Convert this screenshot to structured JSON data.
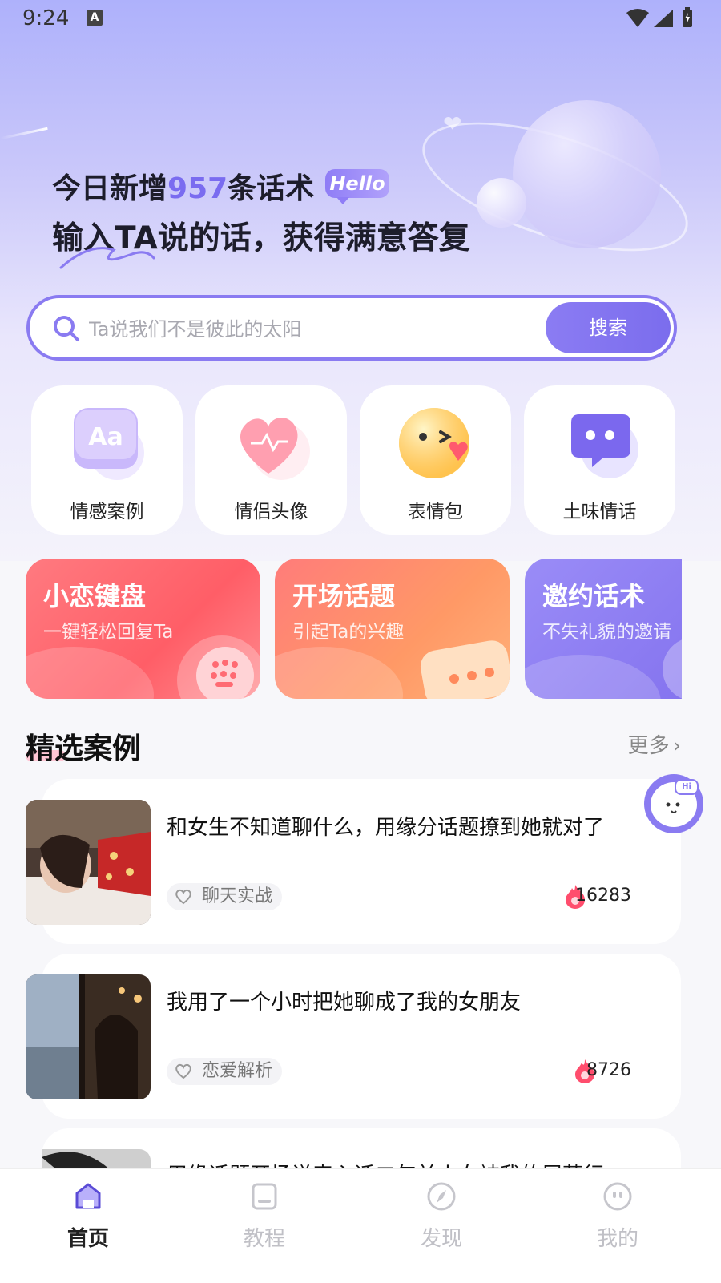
{
  "status_bar": {
    "time": "9:24",
    "notif_icon_letter": "A"
  },
  "header": {
    "line1_prefix": "今日新增",
    "line1_number": "957",
    "line1_suffix": "条话术",
    "hello_badge": "Hello",
    "line2": "输入TA说的话，获得满意答复"
  },
  "search": {
    "placeholder": "Ta说我们不是彼此的太阳",
    "button_label": "搜索"
  },
  "categories": [
    {
      "label": "情感案例",
      "icon": "aa-keycap-icon"
    },
    {
      "label": "情侣头像",
      "icon": "heart-icon"
    },
    {
      "label": "表情包",
      "icon": "wink-emoji-icon"
    },
    {
      "label": "土味情话",
      "icon": "chat-bubble-icon"
    }
  ],
  "banners": [
    {
      "title": "小恋键盘",
      "subtitle": "一键轻松回复Ta"
    },
    {
      "title": "开场话题",
      "subtitle": "引起Ta的兴趣"
    },
    {
      "title": "邀约话术",
      "subtitle": "不失礼貌的邀请"
    }
  ],
  "featured": {
    "title": "精选案例",
    "more_label": "更多",
    "items": [
      {
        "title": "和女生不知道聊什么，用缘分话题撩到她就对了",
        "tag": "聊天实战",
        "count": "16283"
      },
      {
        "title": "我用了一个小时把她聊成了我的女朋友",
        "tag": "恋爱解析",
        "count": "8726"
      },
      {
        "title": "用缘话题开场说表心话二年前火女被我的展蕊行",
        "tag": "",
        "count": ""
      }
    ]
  },
  "mascot_badge": "Hi",
  "tabbar": {
    "items": [
      {
        "label": "首页",
        "active": true
      },
      {
        "label": "教程",
        "active": false
      },
      {
        "label": "发现",
        "active": false
      },
      {
        "label": "我的",
        "active": false
      }
    ]
  },
  "colors": {
    "accent": "#8a7bf1",
    "number_highlight": "#7a6cf0",
    "flame": "#ff4d6d"
  }
}
